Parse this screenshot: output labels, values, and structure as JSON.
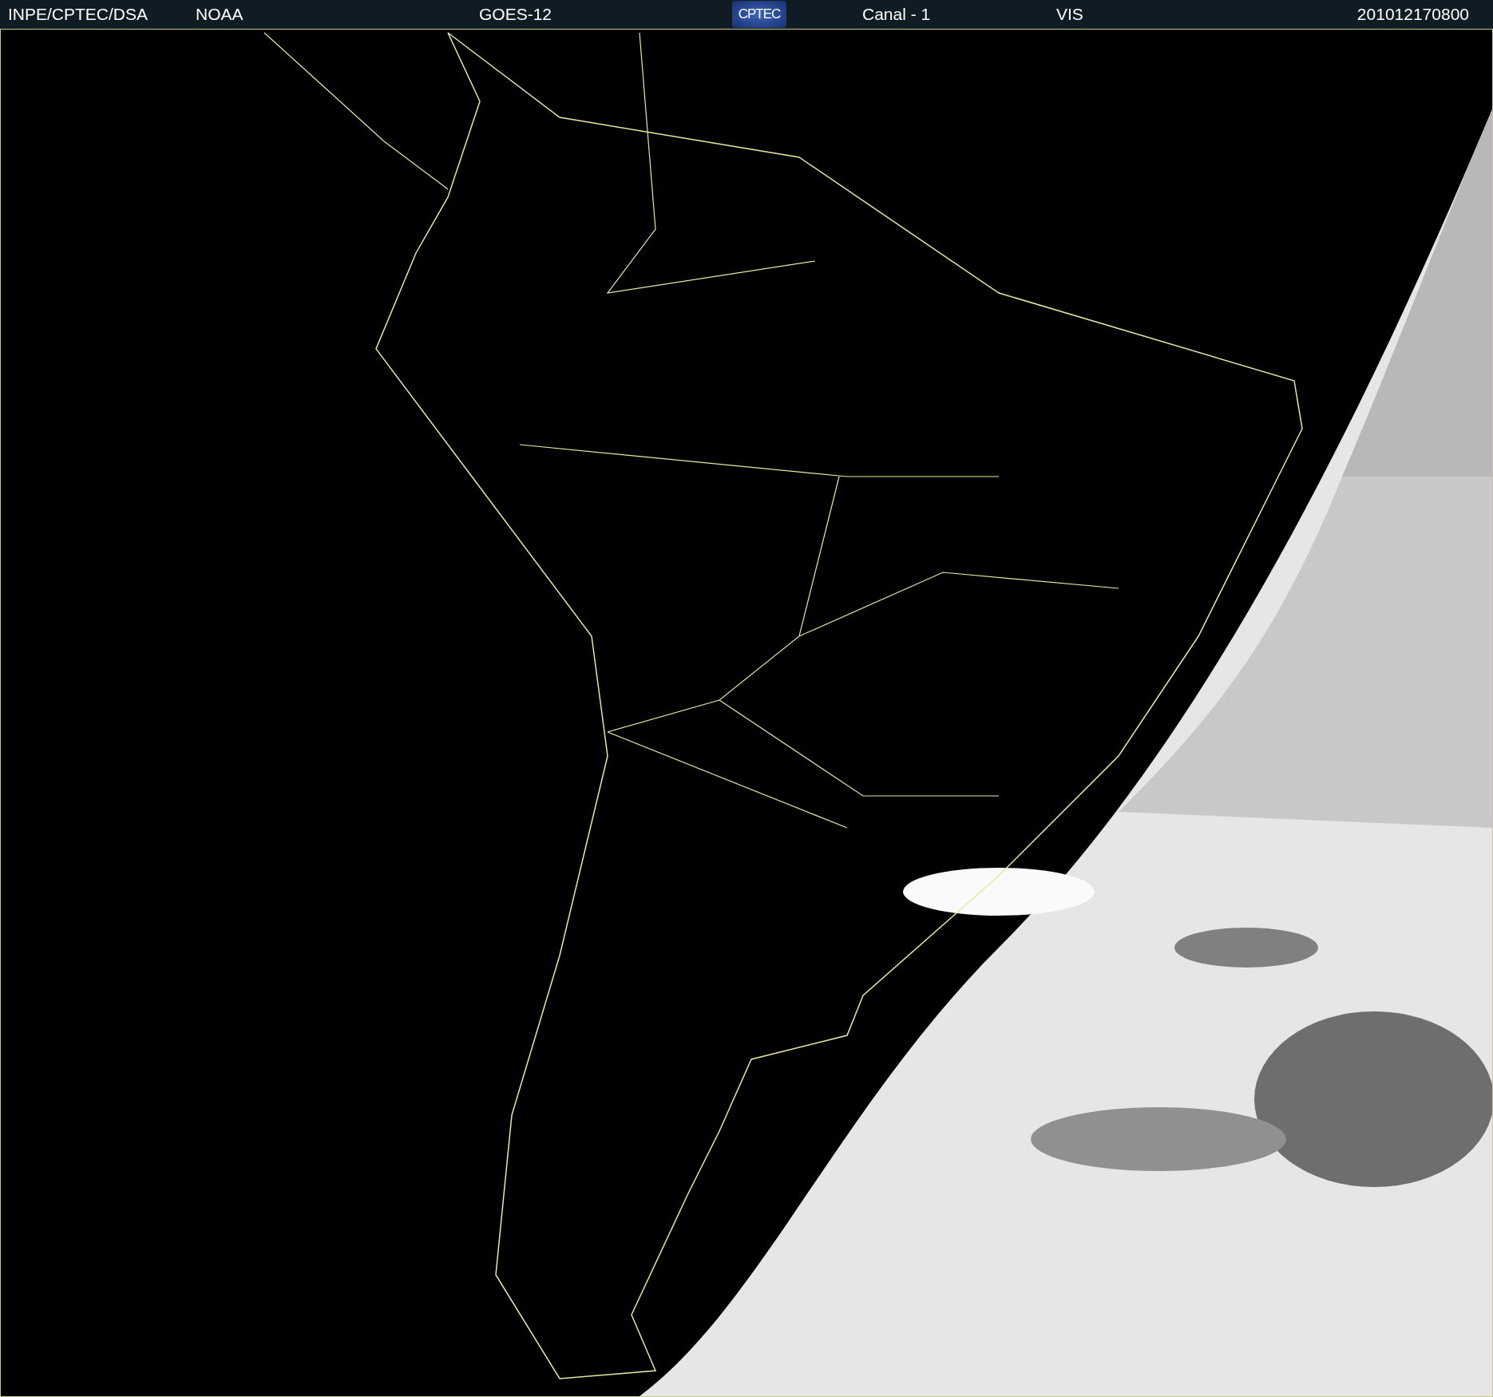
{
  "header": {
    "items": [
      {
        "kind": "text",
        "text": "INPE/CPTEC/DSA"
      },
      {
        "kind": "text",
        "text": "NOAA"
      },
      {
        "kind": "text",
        "text": "GOES-12"
      },
      {
        "kind": "logo",
        "text": "CPTEC"
      },
      {
        "kind": "text",
        "text": "Canal - 1"
      },
      {
        "kind": "text",
        "text": "VIS"
      },
      {
        "kind": "text",
        "text": "201012170800"
      }
    ]
  },
  "image": {
    "kind": "map-picture"
  }
}
